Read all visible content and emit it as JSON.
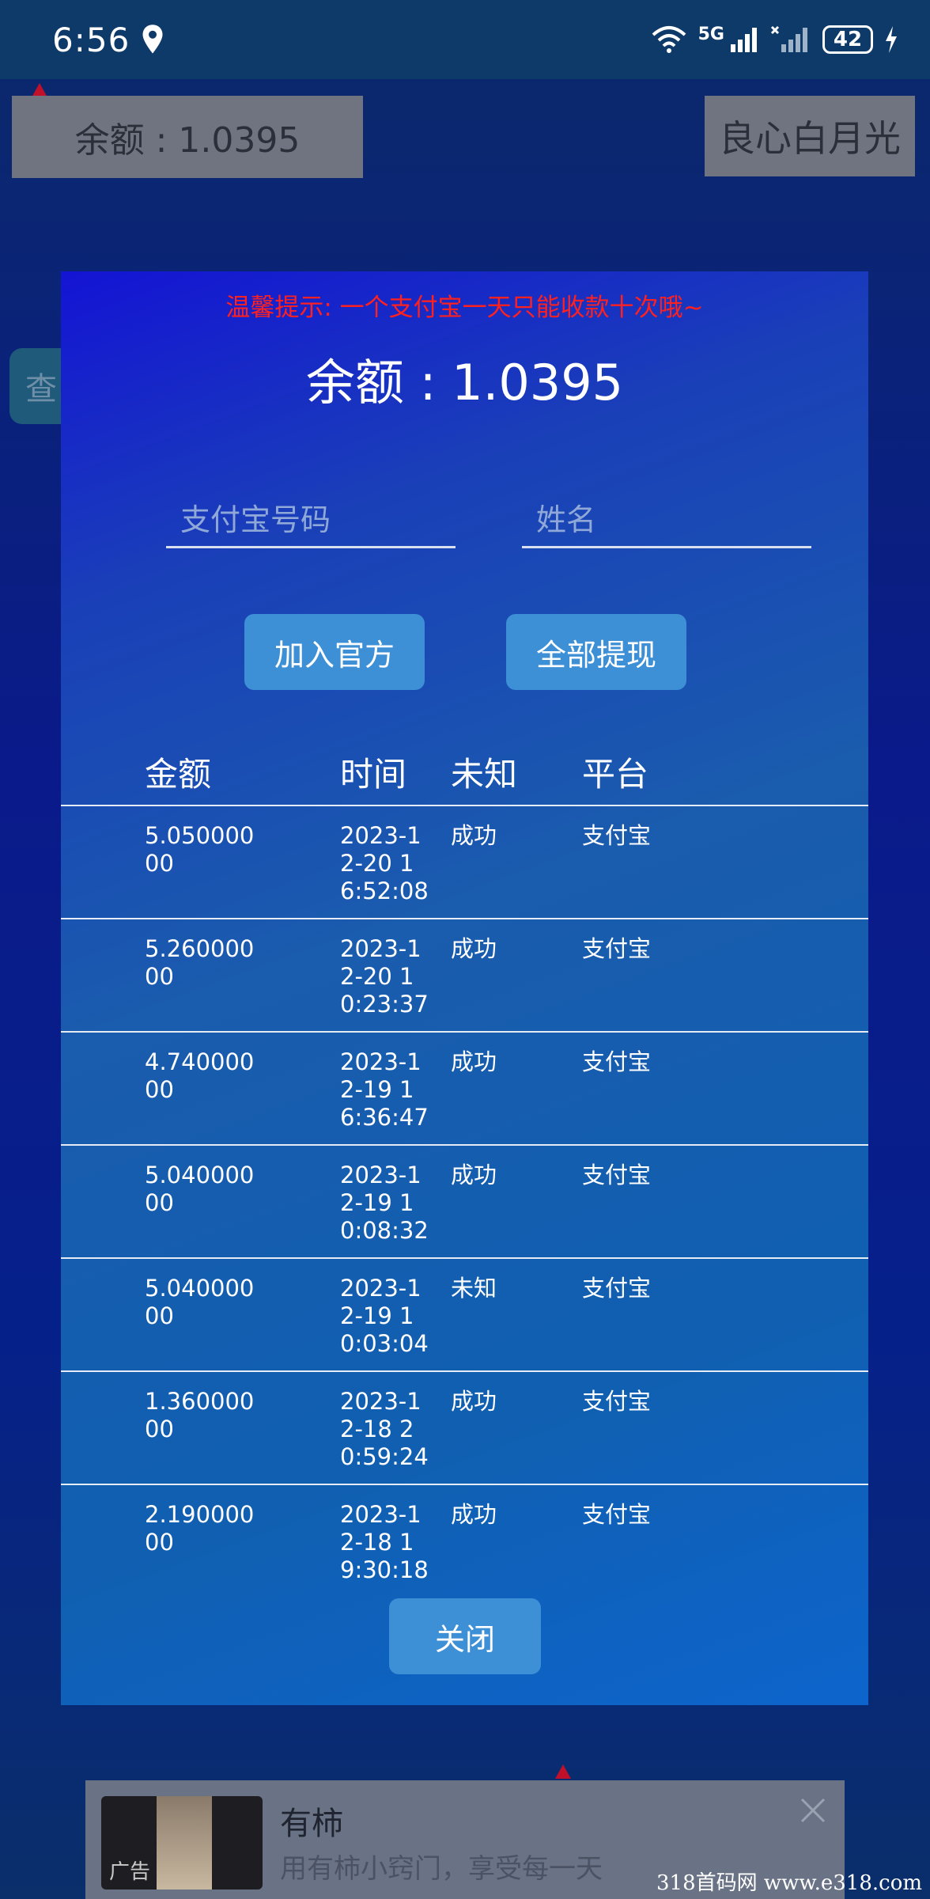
{
  "status_bar": {
    "time": "6:56",
    "network": "5G",
    "battery": "42"
  },
  "background": {
    "balance": "余额 : 1.0395",
    "username": "良心白月光",
    "query_btn": "查"
  },
  "modal": {
    "tip": "温馨提示: 一个支付宝一天只能收款十次哦~",
    "balance": "余额 : 1.0395",
    "alipay_placeholder": "支付宝号码",
    "name_placeholder": "姓名",
    "join_btn": "加入官方",
    "withdraw_btn": "全部提现",
    "close_btn": "关闭",
    "table": {
      "headers": [
        "金额",
        "时间",
        "未知",
        "平台"
      ],
      "rows": [
        {
          "amount": "5.05000000",
          "time": "2023-12-20 16:52:08",
          "status": "成功",
          "platform": "支付宝"
        },
        {
          "amount": "5.26000000",
          "time": "2023-12-20 10:23:37",
          "status": "成功",
          "platform": "支付宝"
        },
        {
          "amount": "4.74000000",
          "time": "2023-12-19 16:36:47",
          "status": "成功",
          "platform": "支付宝"
        },
        {
          "amount": "5.04000000",
          "time": "2023-12-19 10:08:32",
          "status": "成功",
          "platform": "支付宝"
        },
        {
          "amount": "5.04000000",
          "time": "2023-12-19 10:03:04",
          "status": "未知",
          "platform": "支付宝"
        },
        {
          "amount": "1.36000000",
          "time": "2023-12-18 20:59:24",
          "status": "成功",
          "platform": "支付宝"
        },
        {
          "amount": "2.19000000",
          "time": "2023-12-18 19:30:18",
          "status": "成功",
          "platform": "支付宝"
        }
      ]
    }
  },
  "ad": {
    "title": "有柿",
    "description": "用有柿小窍门，享受每一天",
    "tag": "广告"
  },
  "watermark": "318首码网  www.e318.com"
}
